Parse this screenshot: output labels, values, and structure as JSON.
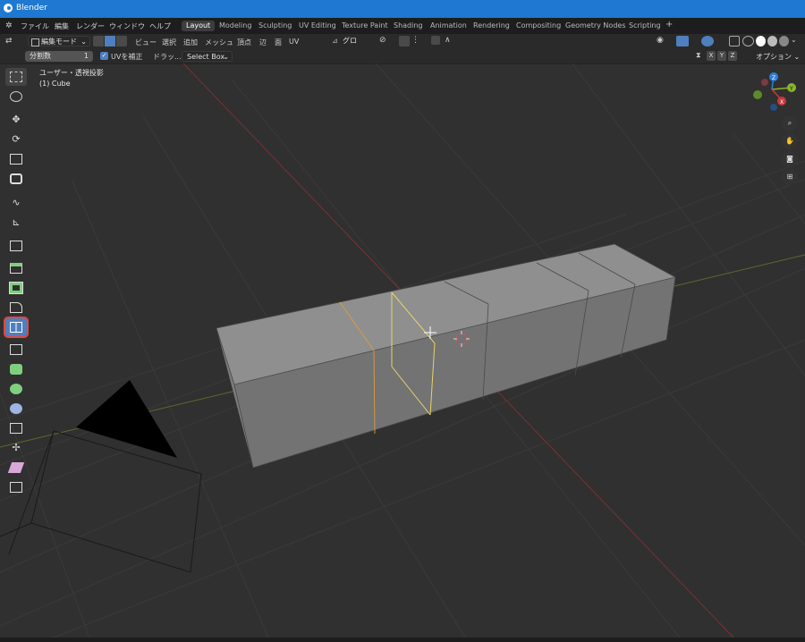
{
  "window": {
    "title": "Blender"
  },
  "menu": [
    "ファイル",
    "編集",
    "レンダー",
    "ウィンドウ",
    "ヘルプ"
  ],
  "workspaces": [
    "Layout",
    "Modeling",
    "Sculpting",
    "UV Editing",
    "Texture Paint",
    "Shading",
    "Animation",
    "Rendering",
    "Compositing",
    "Geometry Nodes",
    "Scripting",
    "+"
  ],
  "active_workspace": "Layout",
  "header": {
    "mode": "編集モード",
    "menus": [
      "ビュー",
      "選択",
      "追加",
      "メッシュ",
      "頂点",
      "辺",
      "面",
      "UV"
    ],
    "transform_orientation": "グロー…"
  },
  "tool_settings": {
    "cuts_label": "分割数",
    "cuts_value": "1",
    "correct_uv": "UVを補正",
    "drag_label": "ドラッ...",
    "drag_value": "Select Box",
    "axes": [
      "X",
      "Y",
      "Z"
    ],
    "options": "オプション"
  },
  "viewport": {
    "view_name": "ユーザー・透視投影",
    "object": "(1) Cube"
  },
  "gizmo": {
    "axes": [
      "X",
      "Y",
      "Z"
    ]
  },
  "colors": {
    "titlebar": "#1f78d1",
    "active_tool": "#4f7fbf",
    "highlight": "#e8463b",
    "x_axis": "#c8383f",
    "y_axis": "#8bb52b",
    "z_axis": "#2f7fd8",
    "selected_edge": "#e7d468",
    "active_edge": "#e09a3a"
  },
  "tools": [
    "select-box-icon",
    "cursor-icon",
    "move-icon",
    "rotate-icon",
    "scale-icon",
    "transform-icon",
    "annotate-icon",
    "measure-icon",
    "add-cube-icon",
    "extrude-icon",
    "inset-icon",
    "bevel-icon",
    "loop-cut-icon",
    "knife-icon",
    "poly-build-icon",
    "spin-icon",
    "smooth-icon",
    "edge-slide-icon",
    "shrink-fatten-icon",
    "shear-icon",
    "rip-icon"
  ]
}
